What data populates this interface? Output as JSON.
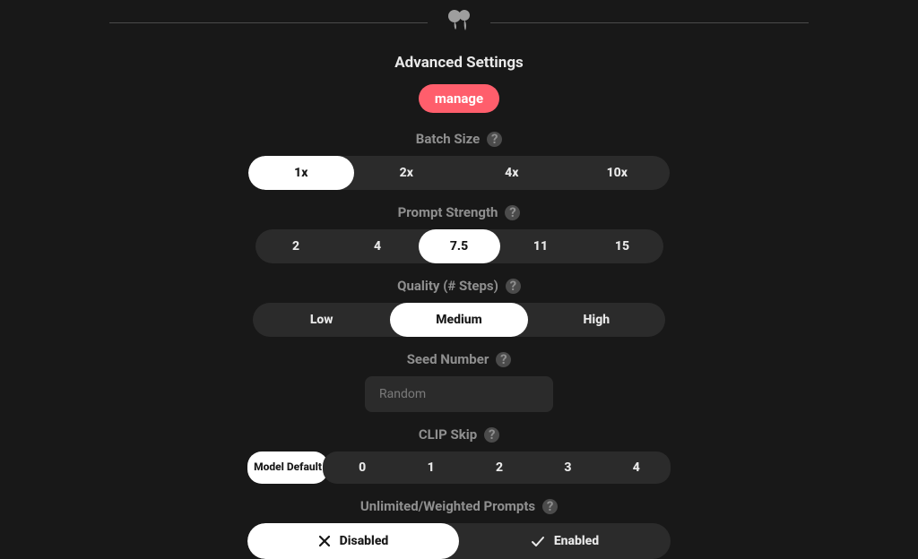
{
  "header": {
    "title": "Advanced Settings"
  },
  "manage": {
    "label": "manage"
  },
  "batch": {
    "label": "Batch Size",
    "options": [
      "1x",
      "2x",
      "4x",
      "10x"
    ],
    "selected": "1x"
  },
  "prompt_strength": {
    "label": "Prompt Strength",
    "options": [
      "2",
      "4",
      "7.5",
      "11",
      "15"
    ],
    "selected": "7.5"
  },
  "quality": {
    "label": "Quality (# Steps)",
    "options": [
      "Low",
      "Medium",
      "High"
    ],
    "selected": "Medium"
  },
  "seed": {
    "label": "Seed Number",
    "placeholder": "Random",
    "value": ""
  },
  "clip_skip": {
    "label": "CLIP Skip",
    "default_label": "Model Default",
    "options": [
      "0",
      "1",
      "2",
      "3",
      "4"
    ],
    "selected": "Model Default"
  },
  "weighted": {
    "label": "Unlimited/Weighted Prompts",
    "disabled_label": "Disabled",
    "enabled_label": "Enabled",
    "selected": "Disabled"
  },
  "help_glyph": "?"
}
